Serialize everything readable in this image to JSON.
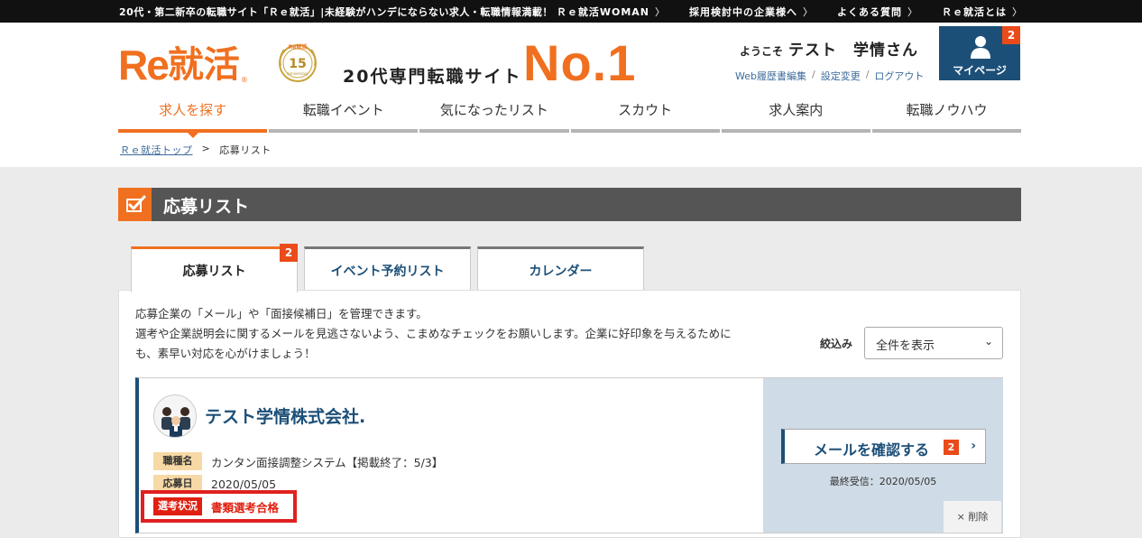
{
  "topbar": {
    "tagline": "20代・第二新卒の転職サイト「Ｒｅ就活」|未経験がハンデにならない求人・転職情報満載！",
    "links": [
      "Ｒｅ就活WOMAN",
      "採用検討中の企業様へ",
      "よくある質問",
      "Ｒｅ就活とは"
    ]
  },
  "header": {
    "logo_re": "Re",
    "logo_jp": "就活",
    "logo_mark": "®",
    "badge_top": "Re就活",
    "badge_number": "15",
    "badge_bottom": "anniversary",
    "tagline": "20代専門転職サイト",
    "no1": "No.1",
    "welcome_prefix": "ようこそ",
    "user_name": "テスト　学情さん",
    "sublinks": [
      "Web履歴書編集",
      "設定変更",
      "ログアウト"
    ],
    "mypage_label": "マイページ",
    "mypage_count": "2"
  },
  "nav": {
    "items": [
      "求人を探す",
      "転職イベント",
      "気になったリスト",
      "スカウト",
      "求人案内",
      "転職ノウハウ"
    ]
  },
  "breadcrumb": {
    "home": "Ｒｅ就活トップ",
    "separator": ">",
    "current": "応募リスト"
  },
  "page": {
    "title": "応募リスト"
  },
  "tabs": [
    {
      "label": "応募リスト",
      "count": "2"
    },
    {
      "label": "イベント予約リスト"
    },
    {
      "label": "カレンダー"
    }
  ],
  "intro": {
    "line1": "応募企業の「メール」や「面接候補日」を管理できます。",
    "line2": "選考や企業説明会に関するメールを見逃さないよう、こまめなチェックをお願いします。企業に好印象を与えるために",
    "line3": "も、素早い対応を心がけましょう！"
  },
  "filter": {
    "label": "絞込み",
    "selected": "全件を表示"
  },
  "application": {
    "company": "テスト学情株式会社.",
    "job_label": "職種名",
    "job_value": "カンタン面接調整システム【掲載終了：5/3】",
    "date_label": "応募日",
    "date_value": "2020/05/05",
    "status_label": "選考状況",
    "status_value": "書類選考合格",
    "mail_button": "メールを確認する",
    "mail_count": "2",
    "last_received": "最終受信：2020/05/05",
    "delete_label": "削除"
  },
  "colors": {
    "brand_orange": "#f07020",
    "navy": "#1c4f78",
    "badge_red": "#ea4b1a",
    "status_red": "#e02010"
  }
}
